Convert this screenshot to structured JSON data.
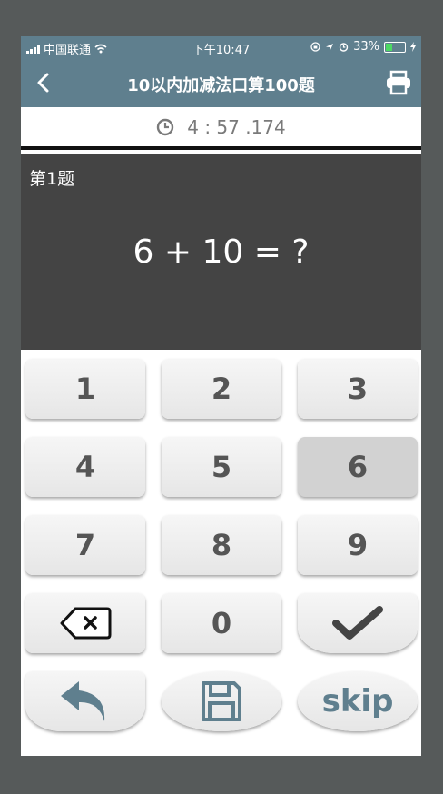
{
  "statusbar": {
    "carrier": "中国联通",
    "time": "下午10:47",
    "battery_text": "33%",
    "battery_level": 0.33
  },
  "nav": {
    "title": "10以内加减法口算100题",
    "back_icon": "chevron-left-icon",
    "print_icon": "printer-icon"
  },
  "timer": {
    "icon": "clock-icon",
    "value": "4 : 57 .174"
  },
  "question": {
    "number_label": "第1题",
    "expression": "6 + 10 = ?"
  },
  "keypad": {
    "keys": [
      "1",
      "2",
      "3",
      "4",
      "5",
      "6",
      "7",
      "8",
      "9",
      "0"
    ],
    "pressed_key": "6",
    "delete_icon": "backspace-icon",
    "confirm_icon": "checkmark-icon",
    "undo_icon": "undo-arrow-icon",
    "save_icon": "floppy-disk-icon",
    "skip_label": "skip"
  },
  "colors": {
    "header": "#5f7f8e",
    "question_bg": "#444444",
    "outer_bg": "#565a5a",
    "accent": "#5f7f8e"
  }
}
